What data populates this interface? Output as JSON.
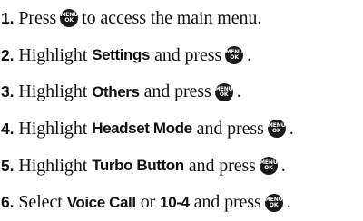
{
  "key_icon": {
    "name": "menu-ok-key-icon",
    "line1": "MENU",
    "line2": "OK"
  },
  "steps": [
    {
      "num": "1.",
      "text_a": "Press",
      "text_b": "to access the main menu."
    },
    {
      "num": "2.",
      "text_a": "Highlight",
      "bold": "Settings",
      "text_b": "and press",
      "end": "."
    },
    {
      "num": "3.",
      "text_a": "Highlight",
      "bold": "Others",
      "text_b": "and press",
      "end": "."
    },
    {
      "num": "4.",
      "text_a": "Highlight",
      "bold": "Headset Mode",
      "text_b": "and press",
      "end": "."
    },
    {
      "num": "5.",
      "text_a": "Highlight",
      "bold": "Turbo Button",
      "text_b": "and press",
      "end": "."
    },
    {
      "num": "6.",
      "text_a": "Select",
      "bold": "Voice Call",
      "text_b": "or",
      "bold2": "10-4",
      "text_c": "and press",
      "end": "."
    }
  ]
}
